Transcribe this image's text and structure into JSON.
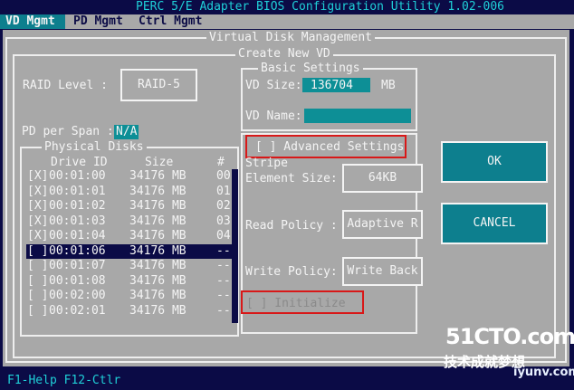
{
  "title_bar": "PERC 5/E Adapter BIOS Configuration Utility 1.02-006",
  "tabs": [
    "VD Mgmt",
    "PD Mgmt",
    "Ctrl Mgmt"
  ],
  "outer_frame_title": "Virtual Disk Management",
  "dialog_title": "Create New VD",
  "raid_level_label": "RAID Level :",
  "raid_level_value": "RAID-5",
  "pd_per_span_label": "PD per Span :",
  "pd_per_span_value": "N/A",
  "physical_disks": {
    "title": "Physical Disks",
    "col_drive": "Drive ID",
    "col_size": "Size",
    "col_num": "#",
    "rows": [
      {
        "check": "[X]",
        "id": "00:01:00",
        "size": "34176 MB",
        "num": "00"
      },
      {
        "check": "[X]",
        "id": "00:01:01",
        "size": "34176 MB",
        "num": "01"
      },
      {
        "check": "[X]",
        "id": "00:01:02",
        "size": "34176 MB",
        "num": "02"
      },
      {
        "check": "[X]",
        "id": "00:01:03",
        "size": "34176 MB",
        "num": "03"
      },
      {
        "check": "[X]",
        "id": "00:01:04",
        "size": "34176 MB",
        "num": "04"
      },
      {
        "check": "[ ]",
        "id": "00:01:06",
        "size": "34176 MB",
        "num": "--"
      },
      {
        "check": "[ ]",
        "id": "00:01:07",
        "size": "34176 MB",
        "num": "--"
      },
      {
        "check": "[ ]",
        "id": "00:01:08",
        "size": "34176 MB",
        "num": "--"
      },
      {
        "check": "[ ]",
        "id": "00:02:00",
        "size": "34176 MB",
        "num": "--"
      },
      {
        "check": "[ ]",
        "id": "00:02:01",
        "size": "34176 MB",
        "num": "--"
      }
    ],
    "selected_index": 5
  },
  "basic_settings": {
    "title": "Basic Settings",
    "vd_size_label": "VD Size:",
    "vd_size_value": "136704",
    "vd_size_unit": "MB",
    "vd_name_label": "VD Name:",
    "vd_name_value": ""
  },
  "advanced_settings_checkbox": "[ ] Advanced Settings",
  "stripe_label": "Stripe",
  "element_size_label": "Element Size:",
  "element_size_value": "64KB",
  "read_policy_label": "Read Policy :",
  "read_policy_value": "Adaptive R",
  "write_policy_label": "Write Policy:",
  "write_policy_value": "Write Back",
  "initialize_checkbox": "[ ] Initialize",
  "ok_label": "OK",
  "cancel_label": "CANCEL",
  "status_bar": "F1-Help F12-Ctlr",
  "watermark": {
    "line1": "51CTO.com",
    "line2": "技术成就梦想",
    "line3": "iyunv.com"
  },
  "colors": {
    "background": "#0b0b46",
    "panel": "#a8a8a8",
    "accent_cyan": "#0d7f8e",
    "highlight_red": "#d81818"
  }
}
